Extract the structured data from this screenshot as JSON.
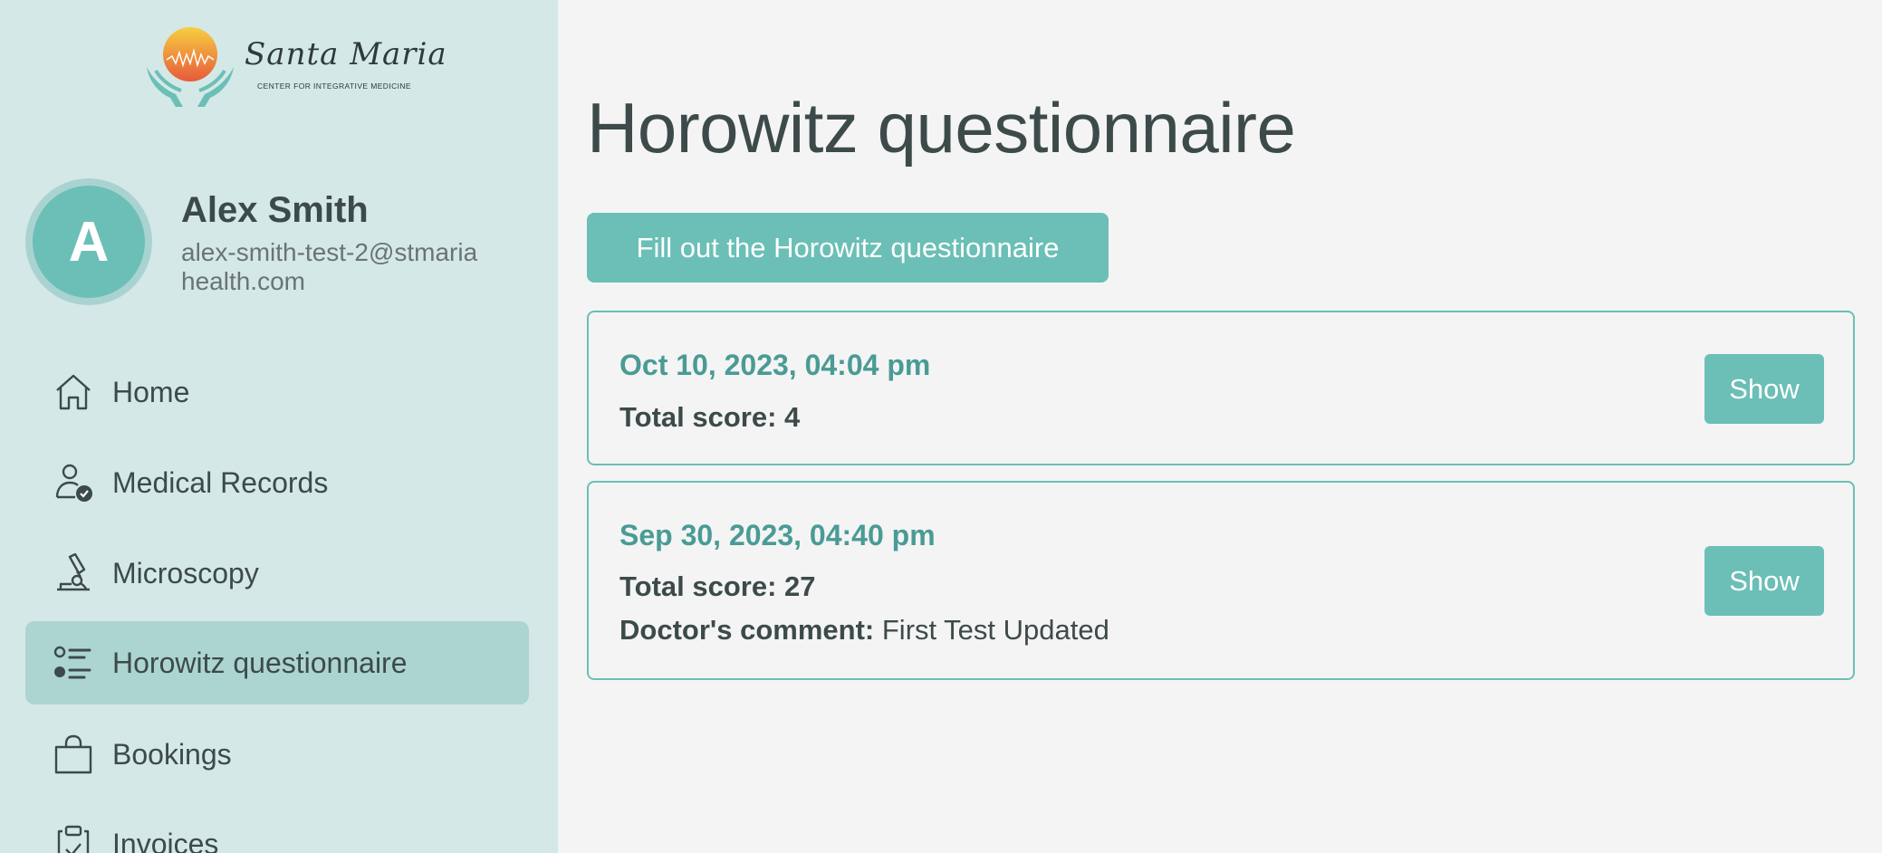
{
  "brand": {
    "script_name": "Santa Maria",
    "tagline": "CENTER FOR INTEGRATIVE MEDICINE",
    "colors": {
      "accent": "#6bbfb6",
      "accent_dark": "#4a9b95",
      "sidebar_bg": "#d4e8e7",
      "active_bg": "#acd5d2"
    }
  },
  "user": {
    "initial": "A",
    "name": "Alex Smith",
    "email": "alex-smith-test-2@stmariahealth.com"
  },
  "sidebar": {
    "items": [
      {
        "label": "Home",
        "icon": "home-icon",
        "active": false
      },
      {
        "label": "Medical Records",
        "icon": "user-check-icon",
        "active": false
      },
      {
        "label": "Microscopy",
        "icon": "microscope-icon",
        "active": false
      },
      {
        "label": "Horowitz questionnaire",
        "icon": "list-icon",
        "active": true
      },
      {
        "label": "Bookings",
        "icon": "shopping-bag-icon",
        "active": false
      },
      {
        "label": "Invoices",
        "icon": "clipboard-check-icon",
        "active": false
      }
    ]
  },
  "main": {
    "title": "Horowitz questionnaire",
    "fill_button": "Fill out the Horowitz questionnaire",
    "entries": [
      {
        "date": "Oct 10, 2023, 04:04 pm",
        "score_label": "Total score:",
        "score": "4",
        "show_label": "Show"
      },
      {
        "date": "Sep 30, 2023, 04:40 pm",
        "score_label": "Total score:",
        "score": "27",
        "comment_label": "Doctor's comment:",
        "comment": "First Test Updated",
        "show_label": "Show"
      }
    ]
  }
}
